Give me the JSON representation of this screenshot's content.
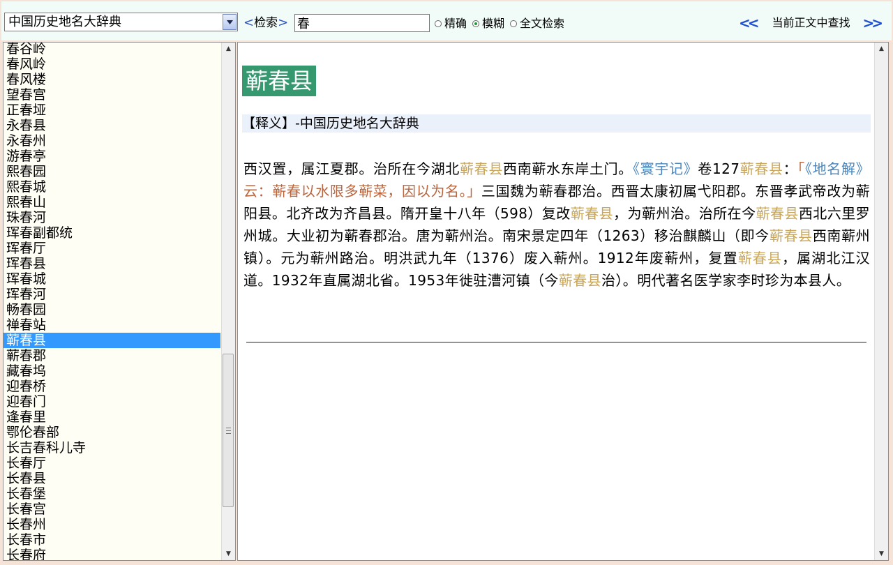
{
  "toolbar": {
    "dictionary": "中国历史地名大辞典",
    "search_label": "检索",
    "search_value": "春",
    "modes": [
      {
        "label": "精确",
        "selected": false
      },
      {
        "label": "模糊",
        "selected": true
      },
      {
        "label": "全文检索",
        "selected": false
      }
    ],
    "prev": "<<",
    "find_label": "当前正文中查找",
    "next": ">>"
  },
  "list": {
    "items": [
      "春谷岭",
      "春风岭",
      "春风楼",
      "望春宫",
      "正春垭",
      "永春县",
      "永春州",
      "游春亭",
      "熙春园",
      "熙春城",
      "熙春山",
      "珠春河",
      "珲春副都统",
      "珲春厅",
      "珲春县",
      "珲春城",
      "珲春河",
      "畅春园",
      "禅春站",
      "蕲春县",
      "蕲春郡",
      "藏春坞",
      "迎春桥",
      "迎春门",
      "逢春里",
      "鄂伦春部",
      "长吉春科儿寺",
      "长春厅",
      "长春县",
      "长春堡",
      "长春宫",
      "长春州",
      "长春市",
      "长春府"
    ],
    "selected_index": 19
  },
  "entry": {
    "title": "蕲春县",
    "source": "【释义】-中国历史地名大辞典",
    "segments": [
      {
        "t": "西汉置，属江夏郡。治所在今湖北",
        "c": "n"
      },
      {
        "t": "蕲春县",
        "c": "hl"
      },
      {
        "t": "西南蕲水东岸土门。",
        "c": "n"
      },
      {
        "t": "《寰宇记》",
        "c": "bk"
      },
      {
        "t": "卷127",
        "c": "n"
      },
      {
        "t": "蕲春县",
        "c": "hl"
      },
      {
        "t": "：",
        "c": "n"
      },
      {
        "t": "「",
        "c": "qt"
      },
      {
        "t": "《地名解》",
        "c": "bk"
      },
      {
        "t": "云：蕲春以水限多蕲菜，因以为名。」",
        "c": "qt"
      },
      {
        "t": "三国魏为蕲春郡治。西晋太康初属弋阳郡。东晋孝武帝改为蕲阳县。北齐改为齐昌县。隋开皇十八年（598）复改",
        "c": "n"
      },
      {
        "t": "蕲春县",
        "c": "hl"
      },
      {
        "t": "，为蕲州治。治所在今",
        "c": "n"
      },
      {
        "t": "蕲春县",
        "c": "hl"
      },
      {
        "t": "西北六里罗州城。大业初为蕲春郡治。唐为蕲州治。南宋景定四年（1263）移治麒麟山（即今",
        "c": "n"
      },
      {
        "t": "蕲春县",
        "c": "hl"
      },
      {
        "t": "西南蕲州镇）。元为蕲州路治。明洪武九年（1376）废入蕲州。1912年废蕲州，复置",
        "c": "n"
      },
      {
        "t": "蕲春县",
        "c": "hl"
      },
      {
        "t": "，属湖北江汉道。1932年直属湖北省。1953年徙驻漕河镇（今",
        "c": "n"
      },
      {
        "t": "蕲春县",
        "c": "hl"
      },
      {
        "t": "治）。明代著名医学家李时珍为本县人。",
        "c": "n"
      }
    ]
  },
  "icons": {
    "dropdown": "triangle-down",
    "scroll_up": "triangle-up",
    "scroll_down": "triangle-down",
    "radio": "circle"
  },
  "colors": {
    "title_bg": "#35986f",
    "selected_bg": "#3399ff",
    "highlight": "#c9a659",
    "book_title": "#4a86bd",
    "quote": "#b9653e",
    "nav_arrow": "#1f4fd0"
  }
}
